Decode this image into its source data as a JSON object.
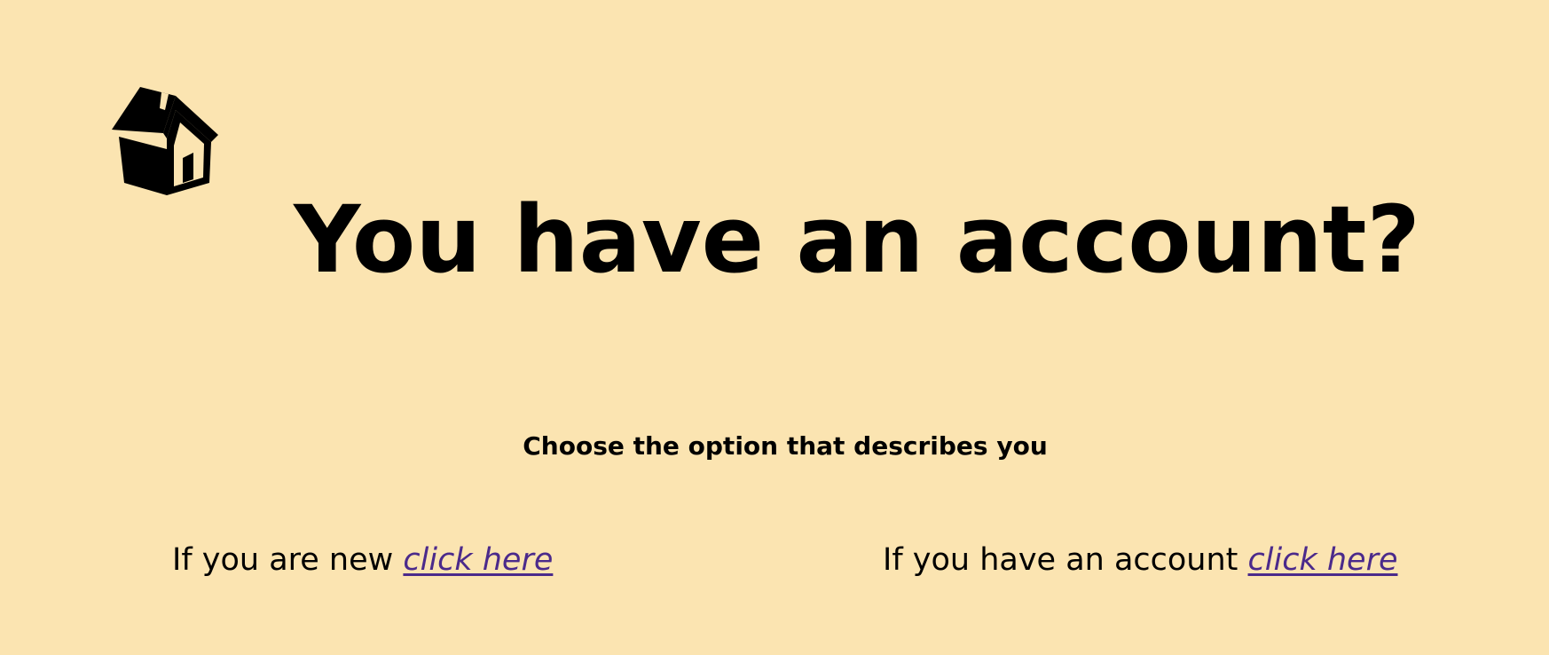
{
  "header": {
    "home_icon": "house-icon",
    "title": "You have an account?"
  },
  "main": {
    "subtitle": "Choose the option that describes you",
    "options": [
      {
        "prefix": "If you are new ",
        "link_label": "click here"
      },
      {
        "prefix": "If you have an account ",
        "link_label": "click here"
      }
    ]
  },
  "colors": {
    "background": "#fbe4b1",
    "text": "#000000",
    "link": "#4b2a8b"
  }
}
